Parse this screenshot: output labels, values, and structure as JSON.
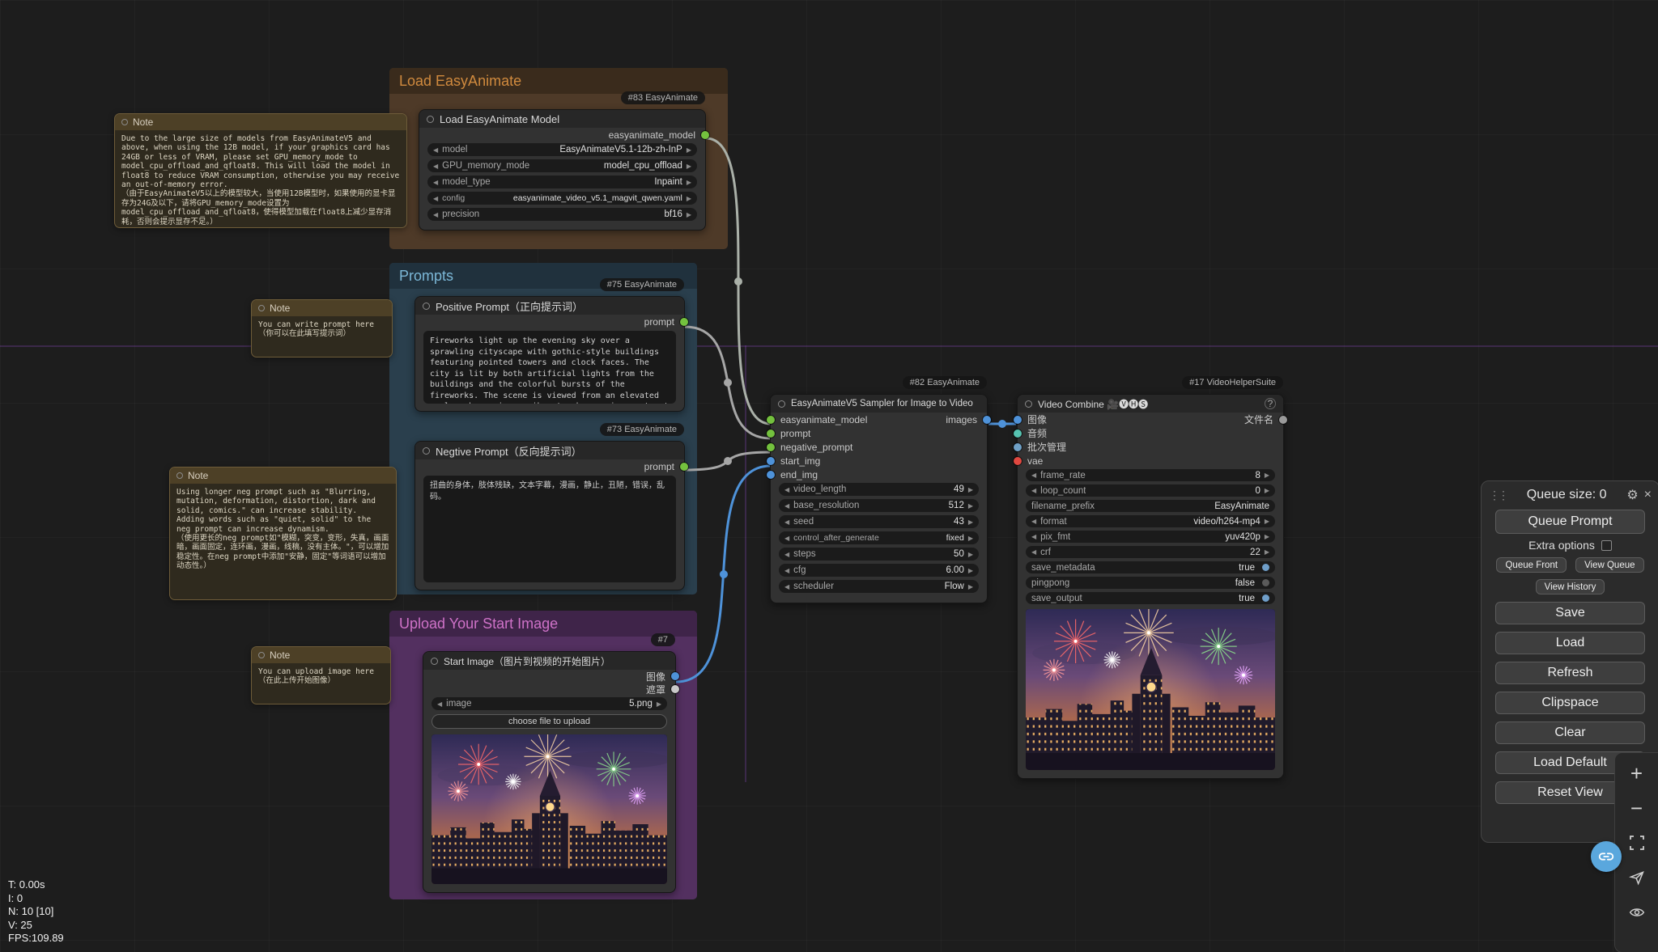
{
  "stats": {
    "l0": "T: 0.00s",
    "l1": "I: 0",
    "l2": "N: 10 [10]",
    "l3": "V: 25",
    "l4": "FPS:109.89"
  },
  "groups": {
    "load": {
      "title": "Load EasyAnimate"
    },
    "prompts": {
      "title": "Prompts"
    },
    "upload": {
      "title": "Upload Your Start Image"
    }
  },
  "notes": {
    "vram": {
      "title": "Note",
      "text": "Due to the large size of models from EasyAnimateV5 and above, when using the 12B model, if your graphics card has 24GB or less of VRAM, please set GPU_memory_mode to model_cpu_offload_and_qfloat8. This will load the model in float8 to reduce VRAM consumption, otherwise you may receive an out-of-memory error.\n（由于EasyAnimateV5以上的模型较大，当使用12B模型时，如果使用的显卡显存为24G及以下，请将GPU_memory_mode设置为model_cpu_offload_and_qfloat8，使得模型加载在float8上减少显存消耗，否则会提示显存不足。）"
    },
    "write_prompt": {
      "title": "Note",
      "text": "You can write prompt here\n（你可以在此填写提示词）"
    },
    "neg_tips": {
      "title": "Note",
      "text": "Using longer neg prompt such as \"Blurring, mutation, deformation, distortion, dark and solid, comics.\" can increase stability. Adding words such as \"quiet, solid\" to the neg prompt can increase dynamism.\n（使用更长的neg prompt如\"模糊，突变，变形，失真，画面暗，画面固定，连环画，漫画，线稿，没有主体。\"，可以增加稳定性。在neg prompt中添加\"安静，固定\"等词语可以增加动态性。）"
    },
    "upload_image": {
      "title": "Note",
      "text": "You can upload image here\n（在此上传开始图像）"
    }
  },
  "nodes": {
    "load_model": {
      "badge": "#83 EasyAnimate",
      "title": "Load EasyAnimate Model",
      "output": "easyanimate_model",
      "widgets": [
        {
          "label": "model",
          "value": "EasyAnimateV5.1-12b-zh-InP"
        },
        {
          "label": "GPU_memory_mode",
          "value": "model_cpu_offload"
        },
        {
          "label": "model_type",
          "value": "Inpaint"
        },
        {
          "label": "config",
          "value": "easyanimate_video_v5.1_magvit_qwen.yaml"
        },
        {
          "label": "precision",
          "value": "bf16"
        }
      ]
    },
    "positive": {
      "badge": "#75 EasyAnimate",
      "title": "Positive Prompt（正向提示词）",
      "output": "prompt",
      "text": "Fireworks light up the evening sky over a sprawling cityscape with gothic-style buildings featuring pointed towers and clock faces. The city is lit by both artificial lights from the buildings and the colorful bursts of the fireworks. The scene is viewed from an elevated angle, showcasing a vibrant urban environment set against a backdrop of a dramatic, partially cloudy sky at dusk."
    },
    "negative": {
      "badge": "#73 EasyAnimate",
      "title": "Negtive Prompt（反向提示词）",
      "output": "prompt",
      "text": "扭曲的身体，肢体残缺，文本字幕，漫画，静止，丑陋，错误，乱码。"
    },
    "start_image": {
      "badge": "#7",
      "title": "Start Image（图片到视频的开始图片）",
      "outputs": [
        "图像",
        "遮罩"
      ],
      "widget": {
        "label": "image",
        "value": "5.png"
      },
      "upload_button": "choose file to upload"
    },
    "sampler": {
      "badge": "#82 EasyAnimate",
      "title": "EasyAnimateV5 Sampler for Image to Video",
      "inputs": [
        "easyanimate_model",
        "prompt",
        "negative_prompt",
        "start_img",
        "end_img"
      ],
      "output": "images",
      "widgets": [
        {
          "label": "video_length",
          "value": "49"
        },
        {
          "label": "base_resolution",
          "value": "512"
        },
        {
          "label": "seed",
          "value": "43"
        },
        {
          "label": "control_after_generate",
          "value": "fixed"
        },
        {
          "label": "steps",
          "value": "50"
        },
        {
          "label": "cfg",
          "value": "6.00"
        },
        {
          "label": "scheduler",
          "value": "Flow"
        }
      ]
    },
    "video_combine": {
      "badge": "#17 VideoHelperSuite",
      "title": "Video Combine 🎥🅥🅗🅢",
      "help": "?",
      "inputs": [
        "图像",
        "音频",
        "批次管理",
        "vae"
      ],
      "output": "文件名",
      "widgets": [
        {
          "label": "frame_rate",
          "value": "8"
        },
        {
          "label": "loop_count",
          "value": "0"
        },
        {
          "label": "filename_prefix",
          "value": "EasyAnimate"
        },
        {
          "label": "format",
          "value": "video/h264-mp4"
        },
        {
          "label": "pix_fmt",
          "value": "yuv420p"
        },
        {
          "label": "crf",
          "value": "22"
        },
        {
          "label": "save_metadata",
          "value": "true"
        },
        {
          "label": "pingpong",
          "value": "false"
        },
        {
          "label": "save_output",
          "value": "true"
        }
      ]
    }
  },
  "menu": {
    "queue_size": "Queue size: 0",
    "queue_prompt": "Queue Prompt",
    "extra_options": "Extra options",
    "queue_front": "Queue Front",
    "view_queue": "View Queue",
    "view_history": "View History",
    "save": "Save",
    "load": "Load",
    "refresh": "Refresh",
    "clipspace": "Clipspace",
    "clear": "Clear",
    "load_default": "Load Default",
    "reset_view": "Reset View"
  }
}
